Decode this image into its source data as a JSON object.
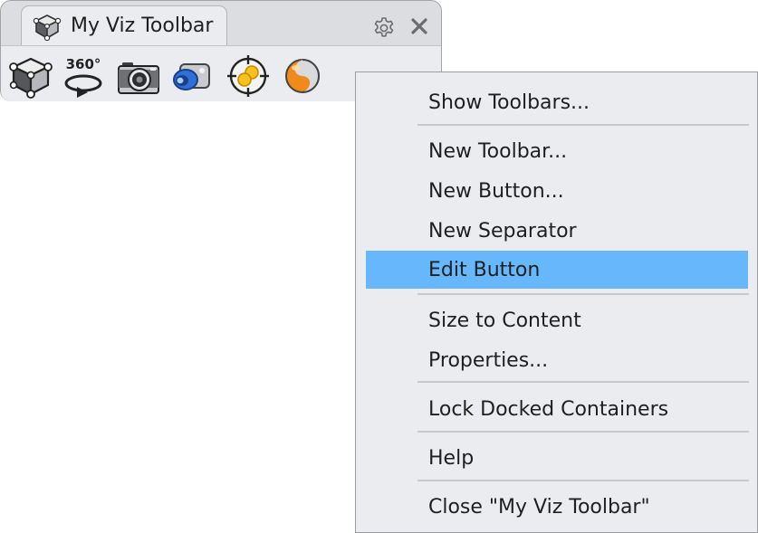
{
  "toolbar": {
    "tab_title": "My Viz Toolbar",
    "tab_icon": "viz-cube-icon",
    "settings_icon": "gear-icon",
    "close_icon": "close-icon",
    "tools": [
      {
        "icon": "view-cube-icon"
      },
      {
        "icon": "rotate-360-icon",
        "label": "360°"
      },
      {
        "icon": "camera-icon"
      },
      {
        "icon": "render-camera-icon"
      },
      {
        "icon": "target-focus-icon"
      },
      {
        "icon": "material-sphere-icon"
      }
    ]
  },
  "context_menu": {
    "items": [
      {
        "label": "Show Toolbars..."
      },
      {
        "label": "New Toolbar..."
      },
      {
        "label": "New Button..."
      },
      {
        "label": "New Separator"
      },
      {
        "label": "Edit Button",
        "highlighted": true
      },
      {
        "label": "Size to Content"
      },
      {
        "label": "Properties..."
      },
      {
        "label": "Lock Docked Containers"
      },
      {
        "label": "Help"
      },
      {
        "label": "Close \"My Viz Toolbar\""
      }
    ]
  },
  "colors": {
    "highlight": "#66b7fc",
    "menu_background": "#ebecf0",
    "panel_background": "#dcdde1",
    "icon_blue": "#2f6fd6",
    "icon_orange": "#f08a1c",
    "icon_yellow": "#f7c21f"
  }
}
